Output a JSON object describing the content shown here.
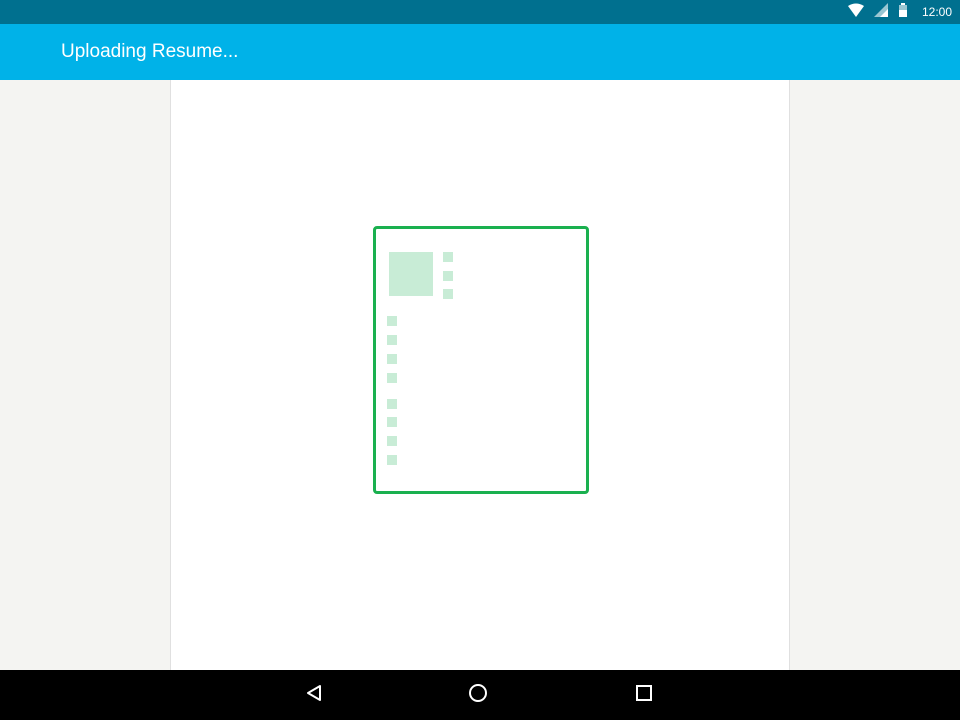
{
  "status_bar": {
    "time": "12:00",
    "icons": [
      "wifi-icon",
      "signal-icon",
      "battery-icon"
    ]
  },
  "app_bar": {
    "title": "Uploading Resume..."
  },
  "nav_bar": {
    "buttons": [
      "back-icon",
      "home-icon",
      "recents-icon"
    ]
  },
  "colors": {
    "status_bar": "#00708f",
    "app_bar": "#00b2e8",
    "accent": "#1ab04f",
    "placeholder": "#c8ecd6",
    "background": "#f4f4f2"
  }
}
